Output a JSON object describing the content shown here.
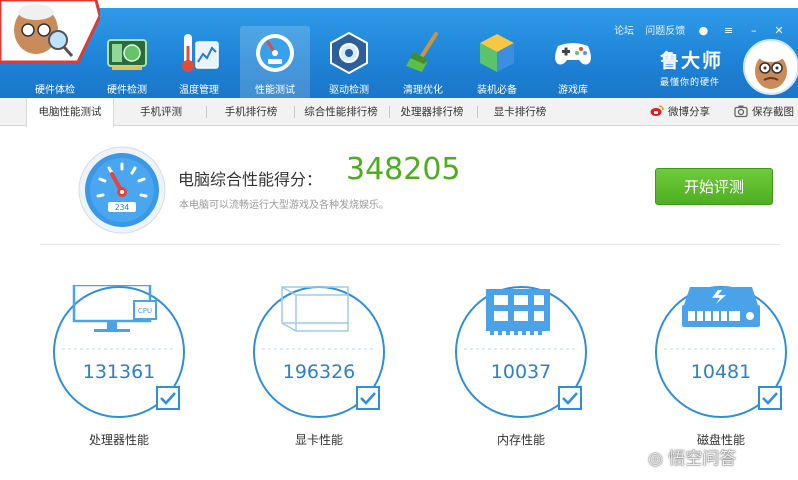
{
  "app": {
    "brand_title": "鲁大师",
    "brand_slogan": "最懂你的硬件"
  },
  "top_links": {
    "forum": "论坛",
    "feedback": "问题反馈"
  },
  "toolbar": [
    {
      "label": "硬件体检",
      "icon": "hardware-check-icon"
    },
    {
      "label": "硬件检测",
      "icon": "hardware-detect-icon"
    },
    {
      "label": "温度管理",
      "icon": "temperature-icon"
    },
    {
      "label": "性能测试",
      "icon": "performance-icon",
      "active": true
    },
    {
      "label": "驱动检测",
      "icon": "driver-icon"
    },
    {
      "label": "清理优化",
      "icon": "broom-icon"
    },
    {
      "label": "装机必备",
      "icon": "package-icon"
    },
    {
      "label": "游戏库",
      "icon": "gamepad-icon"
    }
  ],
  "tabs": [
    {
      "label": "电脑性能测试",
      "active": true
    },
    {
      "label": "手机评测"
    },
    {
      "label": "手机排行榜"
    },
    {
      "label": "综合性能排行榜"
    },
    {
      "label": "处理器排行榜"
    },
    {
      "label": "显卡排行榜"
    }
  ],
  "share": {
    "weibo": "微博分享",
    "screenshot": "保存截图"
  },
  "score": {
    "label": "电脑综合性能得分：",
    "value": "348205",
    "description": "本电脑可以流畅运行大型游戏及各种发烧娱乐。",
    "gauge_digits": "234"
  },
  "start_button": "开始评测",
  "components": [
    {
      "label": "处理器性能",
      "score": "131361",
      "icon": "cpu-monitor-icon"
    },
    {
      "label": "显卡性能",
      "score": "196326",
      "icon": "graphics-card-icon"
    },
    {
      "label": "内存性能",
      "score": "10037",
      "icon": "memory-icon"
    },
    {
      "label": "磁盘性能",
      "score": "10481",
      "icon": "disk-icon"
    }
  ],
  "watermark": "悟空问答",
  "colors": {
    "accent_blue": "#1e82d6",
    "score_green": "#4cae1c",
    "button_green": "#55b526",
    "circle_blue": "#2f8fdc"
  }
}
